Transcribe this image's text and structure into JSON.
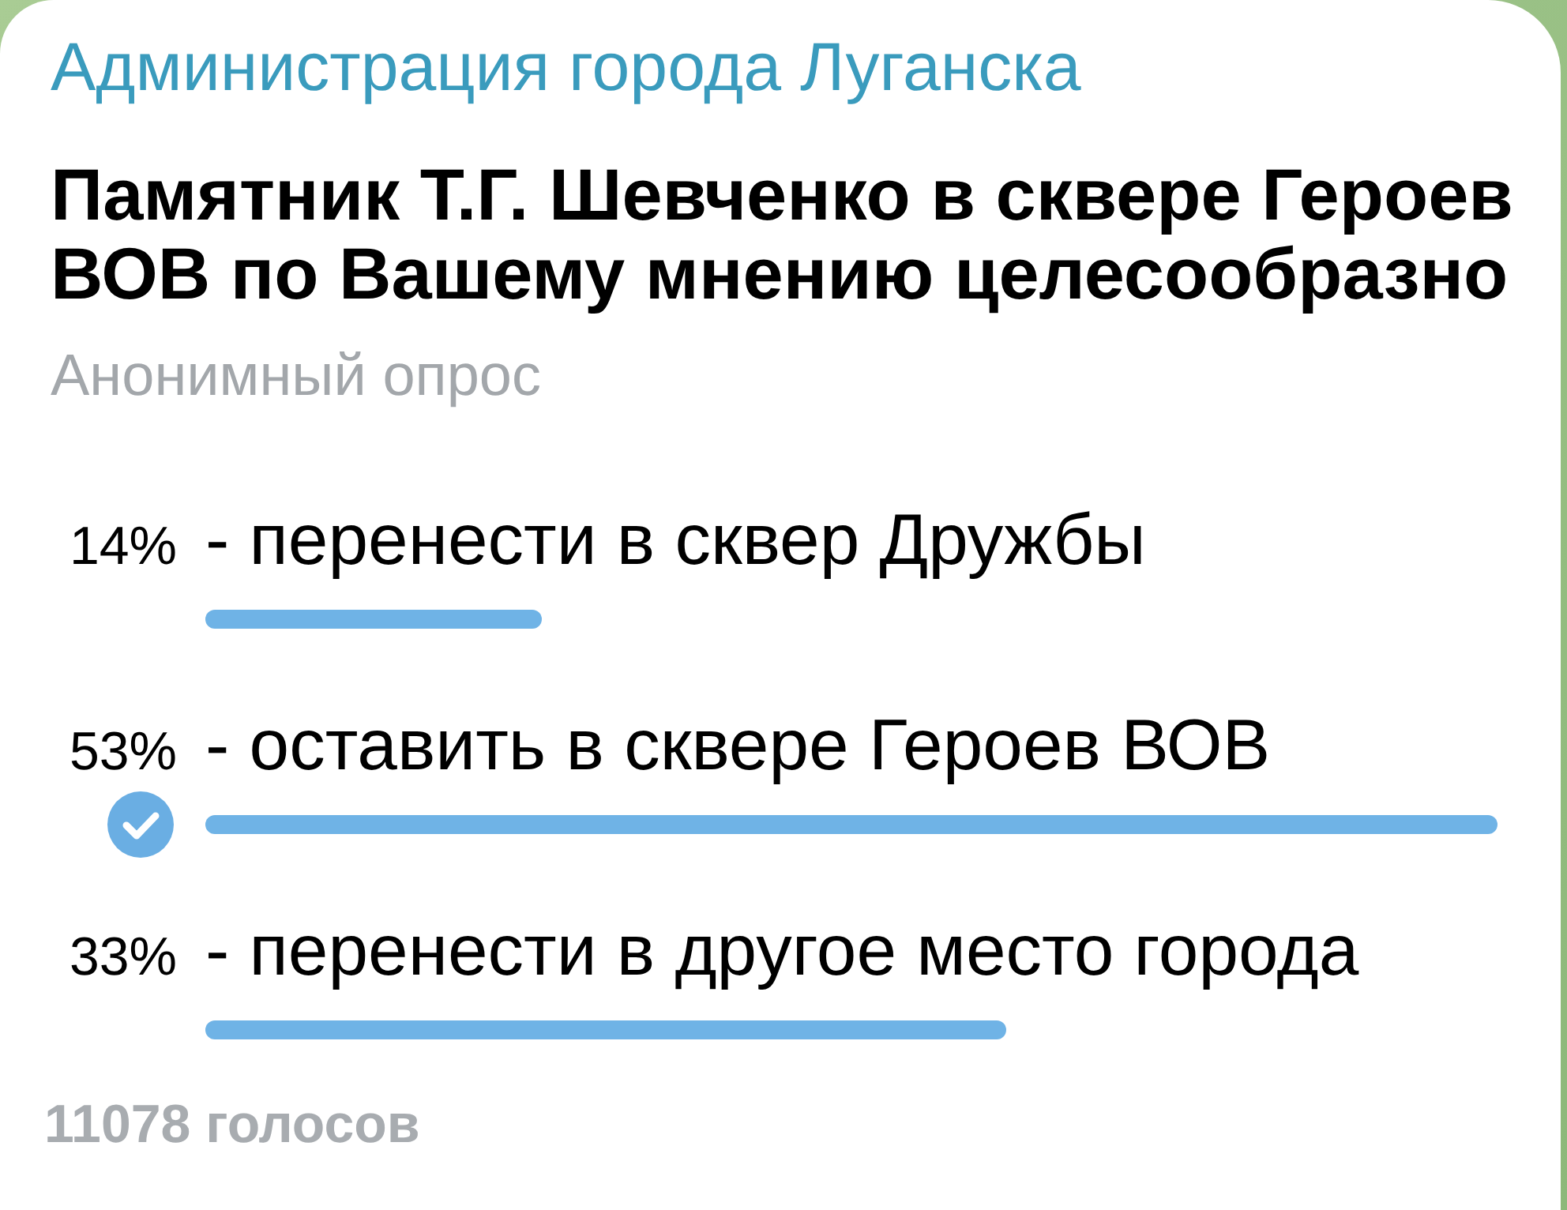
{
  "channel": {
    "name": "Администрация города Луганска"
  },
  "poll": {
    "question": "Памятник Т.Г. Шевченко в сквере Героев ВОВ по Вашему мнению целесообразно",
    "type_label": "Анонимный опрос",
    "options": [
      {
        "percent": "14%",
        "text": "- перенести в сквер Дружбы",
        "level": 0.26,
        "selected": false
      },
      {
        "percent": "53%",
        "text": "- оставить в сквере Героев ВОВ",
        "level": 1,
        "selected": true
      },
      {
        "percent": "33%",
        "text": "- перенести в другое место города",
        "level": 0.62,
        "selected": false
      }
    ],
    "votes": "11078 голосов"
  }
}
